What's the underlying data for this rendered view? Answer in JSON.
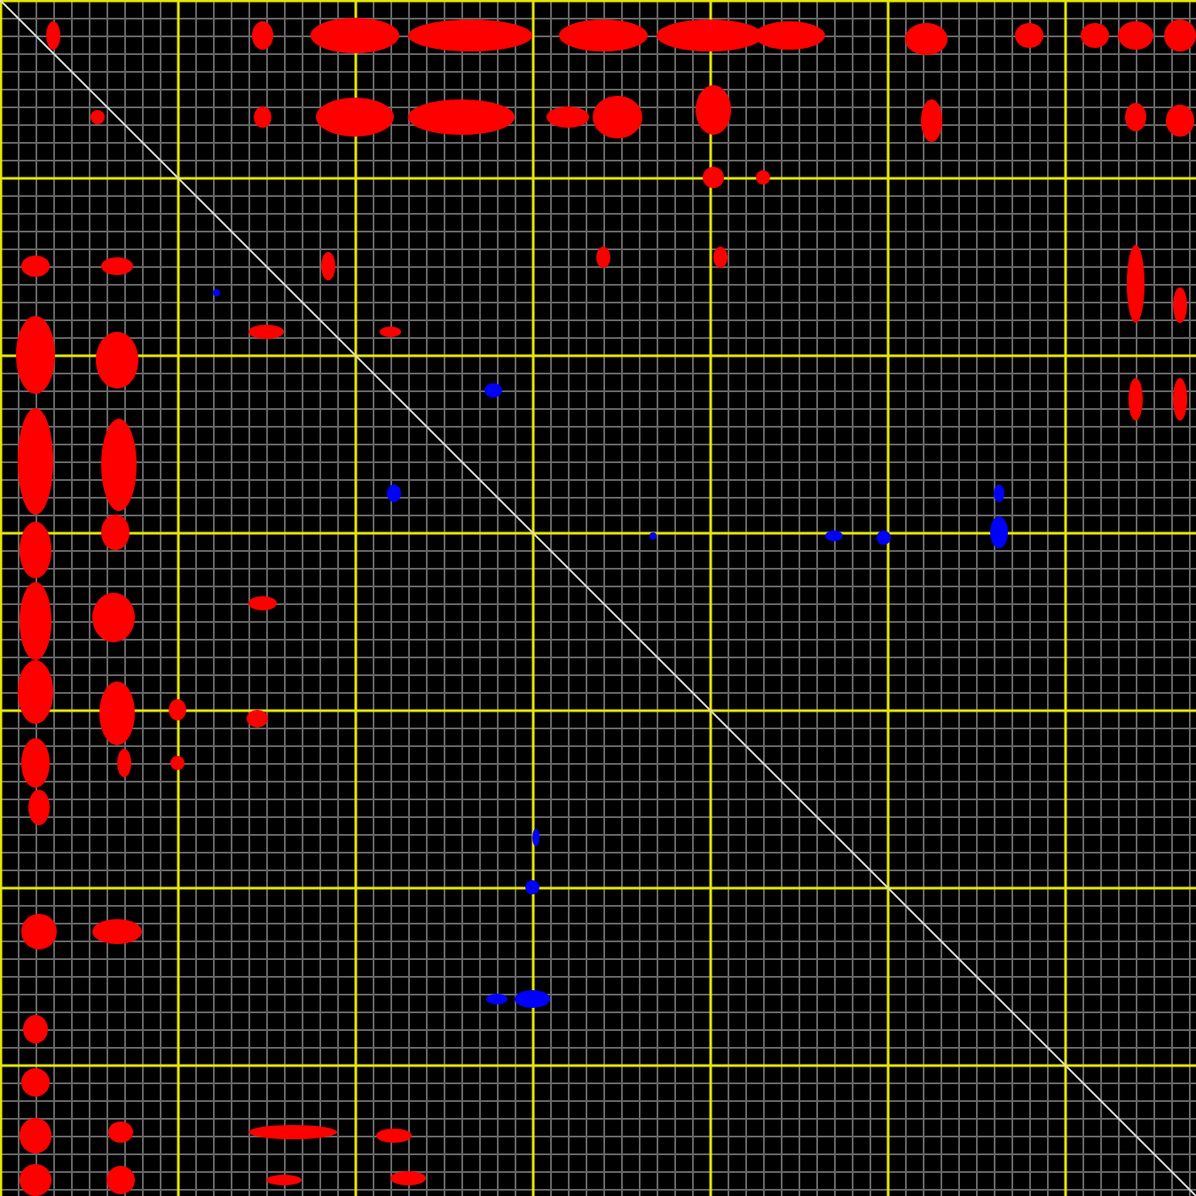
{
  "plot": {
    "kind": "matrix"
  }
}
